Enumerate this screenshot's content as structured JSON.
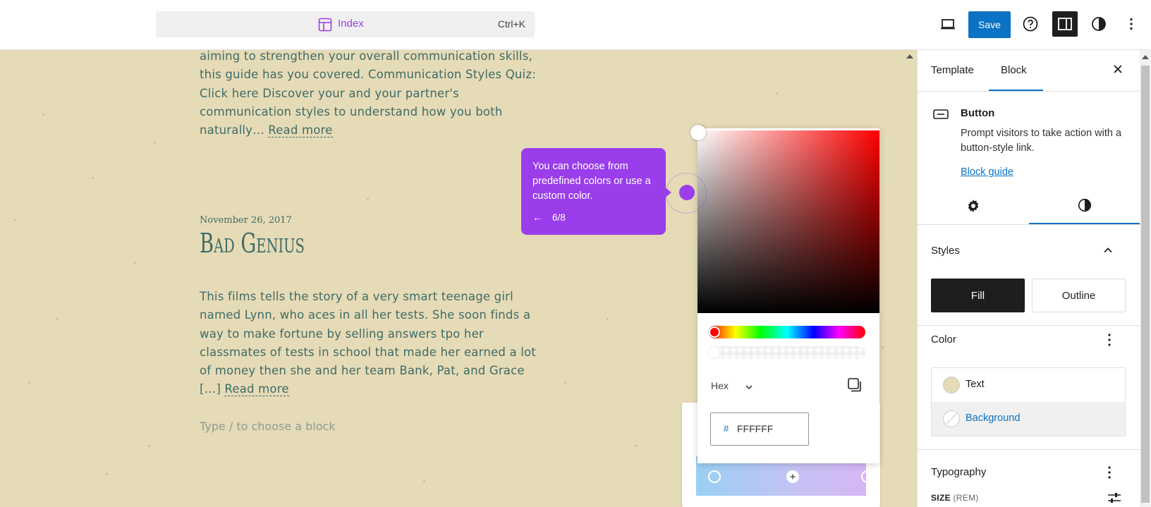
{
  "topbar": {
    "command_title": "Index",
    "command_shortcut": "Ctrl+K",
    "save_label": "Save"
  },
  "canvas": {
    "post1_text": "aiming to strengthen your overall communication skills, this guide has you covered. Communication Styles Quiz: Click here Discover your and your partner's communication styles to understand how you both naturally… ",
    "post1_read_more": "Read more",
    "post2_date": "November 26, 2017",
    "post2_title": "Bad Genius",
    "post2_text": "This films tells the story of a very smart teenage girl named Lynn, who aces in all her tests. She soon finds a way to make fortune by selling answers tpo her classmates of tests in school that made her earned a lot of money then she and her team Bank, Pat, and Grace […] ",
    "post2_read_more": "Read more",
    "block_placeholder": "Type / to choose a block"
  },
  "tour": {
    "text": "You can choose from predefined colors or use a custom color.",
    "back_icon": "←",
    "step": "6/8",
    "accent": "#9a3deb"
  },
  "picker": {
    "format": "Hex",
    "hex_prefix": "#",
    "hex_value": "FFFFFF",
    "hue_color": "#ff0000"
  },
  "sidebar": {
    "tab_template": "Template",
    "tab_block": "Block",
    "block_name": "Button",
    "block_description": "Prompt visitors to take action with a button-style link.",
    "block_guide": "Block guide",
    "styles_title": "Styles",
    "fill_label": "Fill",
    "outline_label": "Outline",
    "color_title": "Color",
    "color_text_label": "Text",
    "color_background_label": "Background",
    "typography_title": "Typography",
    "size_label": "SIZE",
    "size_unit": "(REM)",
    "text_swatch_color": "#e6dbb7",
    "accent": "#0b72c4"
  }
}
